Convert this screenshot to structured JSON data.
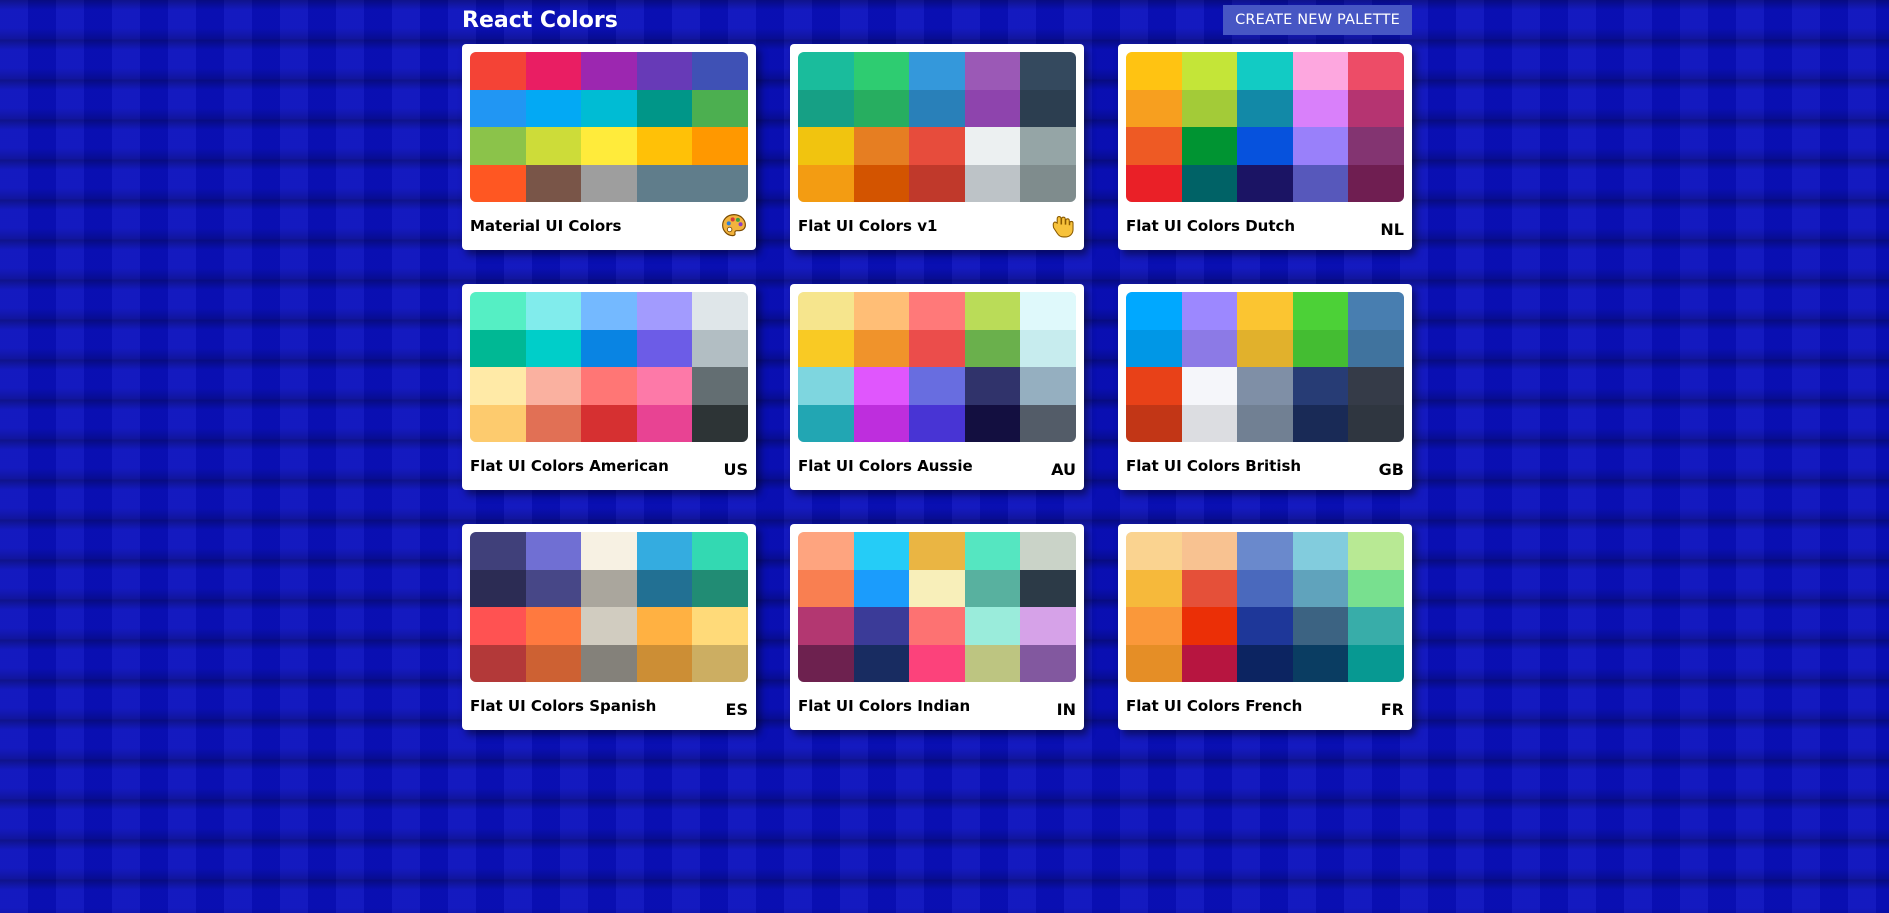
{
  "header": {
    "title": "React Colors",
    "create_button": "CREATE NEW PALETTE"
  },
  "palettes": [
    {
      "name": "Material UI Colors",
      "emoji": "palette-icon",
      "colors": [
        "#F44336",
        "#E91E63",
        "#9C27B0",
        "#673AB7",
        "#3F51B5",
        "#2196F3",
        "#03A9F4",
        "#00BCD4",
        "#009688",
        "#4CAF50",
        "#8BC34A",
        "#CDDC39",
        "#FFEB3B",
        "#FFC107",
        "#FF9800",
        "#FF5722",
        "#795548",
        "#9E9E9E",
        "#607D8B",
        "#607D8B"
      ]
    },
    {
      "name": "Flat UI Colors v1",
      "emoji": "hand-icon",
      "colors": [
        "#1ABC9C",
        "#2ECC71",
        "#3498DB",
        "#9B59B6",
        "#34495E",
        "#16A085",
        "#27AE60",
        "#2980B9",
        "#8E44AD",
        "#2C3E50",
        "#F1C40F",
        "#E67E22",
        "#E74C3C",
        "#ECF0F1",
        "#95A5A6",
        "#F39C12",
        "#D35400",
        "#C0392B",
        "#BDC3C7",
        "#7F8C8D"
      ]
    },
    {
      "name": "Flat UI Colors Dutch",
      "emoji": "NL",
      "colors": [
        "#FFC312",
        "#C4E538",
        "#12CBC4",
        "#FDA7DF",
        "#ED4C67",
        "#F79F1F",
        "#A3CB38",
        "#1289A7",
        "#D980FA",
        "#B53471",
        "#EE5A24",
        "#009432",
        "#0652DD",
        "#9980FA",
        "#833471",
        "#EA2027",
        "#006266",
        "#1B1464",
        "#5758BB",
        "#6F1E51"
      ]
    },
    {
      "name": "Flat UI Colors American",
      "emoji": "US",
      "colors": [
        "#55EFC4",
        "#81ECEC",
        "#74B9FF",
        "#A29BFE",
        "#DFE6E9",
        "#00B894",
        "#00CEC9",
        "#0984E3",
        "#6C5CE7",
        "#B2BEC3",
        "#FFEAA7",
        "#FAB1A0",
        "#FF7675",
        "#FD79A8",
        "#636E72",
        "#FDCB6E",
        "#E17055",
        "#D63031",
        "#E84393",
        "#2D3436"
      ]
    },
    {
      "name": "Flat UI Colors Aussie",
      "emoji": "AU",
      "colors": [
        "#F6E58D",
        "#FFBE76",
        "#FF7979",
        "#BADC58",
        "#DFF9FB",
        "#F9CA24",
        "#F0932B",
        "#EB4D4B",
        "#6AB04C",
        "#C7ECEE",
        "#7ED6DF",
        "#E056FD",
        "#686DE0",
        "#30336B",
        "#95AFC0",
        "#22A6B3",
        "#BE2EDD",
        "#4834D4",
        "#130F40",
        "#535C68"
      ]
    },
    {
      "name": "Flat UI Colors British",
      "emoji": "GB",
      "colors": [
        "#00A8FF",
        "#9C88FF",
        "#FBC531",
        "#4CD137",
        "#487EB0",
        "#0097E6",
        "#8C7AE6",
        "#E1B12C",
        "#44BD32",
        "#40739E",
        "#E84118",
        "#F5F6FA",
        "#7F8FA6",
        "#273C75",
        "#353B48",
        "#C23616",
        "#DCDDE1",
        "#718093",
        "#192A56",
        "#2F3640"
      ]
    },
    {
      "name": "Flat UI Colors Spanish",
      "emoji": "ES",
      "colors": [
        "#40407A",
        "#706FD3",
        "#F7F1E3",
        "#34ACE0",
        "#33D9B2",
        "#2C2C54",
        "#474787",
        "#AAA69D",
        "#227093",
        "#218C74",
        "#FF5252",
        "#FF793F",
        "#D1CCC0",
        "#FFB142",
        "#FFDA79",
        "#B33939",
        "#CD6133",
        "#84817A",
        "#CC8E35",
        "#CCAE62"
      ]
    },
    {
      "name": "Flat UI Colors Indian",
      "emoji": "IN",
      "colors": [
        "#FEA47F",
        "#25CCF7",
        "#EAB543",
        "#55E6C1",
        "#CAD3C8",
        "#F97F51",
        "#1B9CFC",
        "#F8EFBA",
        "#58B19F",
        "#2C3A47",
        "#B33771",
        "#3B3B98",
        "#FD7272",
        "#9AECDB",
        "#D6A2E8",
        "#6D214F",
        "#182C61",
        "#FC427B",
        "#BDC581",
        "#82589F"
      ]
    },
    {
      "name": "Flat UI Colors French",
      "emoji": "FR",
      "colors": [
        "#FAD390",
        "#F8C291",
        "#6A89CC",
        "#82CCDD",
        "#B8E994",
        "#F6B93B",
        "#E55039",
        "#4A69BD",
        "#60A3BC",
        "#78E08F",
        "#FA983A",
        "#EB2F06",
        "#1E3799",
        "#3C6382",
        "#38ADA9",
        "#E58E26",
        "#B71540",
        "#0C2461",
        "#0A3D62",
        "#079992"
      ]
    }
  ]
}
